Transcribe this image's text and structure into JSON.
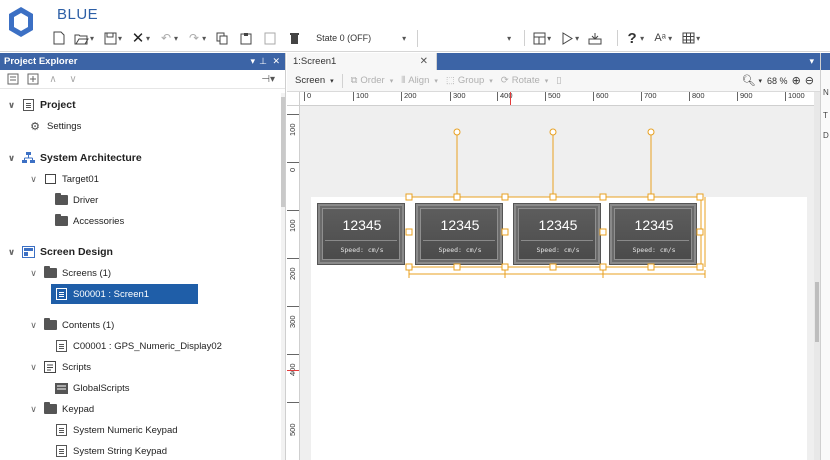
{
  "app": {
    "name": "BLUE"
  },
  "toolbar": {
    "state_value": "State 0 (OFF)",
    "help": "?"
  },
  "explorer": {
    "title": "Project Explorer",
    "controls": "▾ # ✕",
    "tree": [
      {
        "label": "Project",
        "bold": true
      },
      {
        "label": "Settings"
      },
      {
        "label": "System Architecture",
        "bold": true
      },
      {
        "label": "Target01"
      },
      {
        "label": "Driver"
      },
      {
        "label": "Accessories"
      },
      {
        "label": "Screen Design",
        "bold": true
      },
      {
        "label": "Screens (1)"
      },
      {
        "label": "S00001 : Screen1",
        "selected": true
      },
      {
        "label": "Contents (1)"
      },
      {
        "label": "C00001 : GPS_Numeric_Display02"
      },
      {
        "label": "Scripts"
      },
      {
        "label": "GlobalScripts"
      },
      {
        "label": "Keypad"
      },
      {
        "label": "System Numeric Keypad"
      },
      {
        "label": "System String Keypad"
      }
    ]
  },
  "editor": {
    "tab_label": "1:Screen1",
    "toolbar": {
      "screen": "Screen",
      "order": "Order",
      "align": "Align",
      "group": "Group",
      "rotate": "Rotate"
    },
    "zoom": "68 %",
    "ruler_h": [
      "0",
      "100",
      "200",
      "300",
      "400",
      "500",
      "600",
      "700",
      "800",
      "900",
      "1000"
    ],
    "ruler_v": [
      "100",
      "0",
      "100",
      "200",
      "300",
      "400",
      "500"
    ]
  },
  "displays": [
    {
      "value": "12345",
      "unit": "Speed: cm/s"
    },
    {
      "value": "12345",
      "unit": "Speed: cm/s"
    },
    {
      "value": "12345",
      "unit": "Speed: cm/s"
    },
    {
      "value": "12345",
      "unit": "Speed: cm/s"
    }
  ],
  "colors": {
    "accent": "#3c64a6",
    "selection": "#1f5ea8",
    "handle": "#e8a020"
  },
  "icons": [
    "app-logo-icon",
    "new-file-icon",
    "open-folder-icon",
    "save-icon",
    "delete-icon",
    "undo-icon",
    "redo-icon",
    "copy-icon",
    "paste-icon",
    "run-icon",
    "transfer-icon",
    "help-icon",
    "font-icon",
    "table-icon",
    "zoom-out-icon",
    "zoom-in-icon",
    "zoom-fit-icon"
  ]
}
